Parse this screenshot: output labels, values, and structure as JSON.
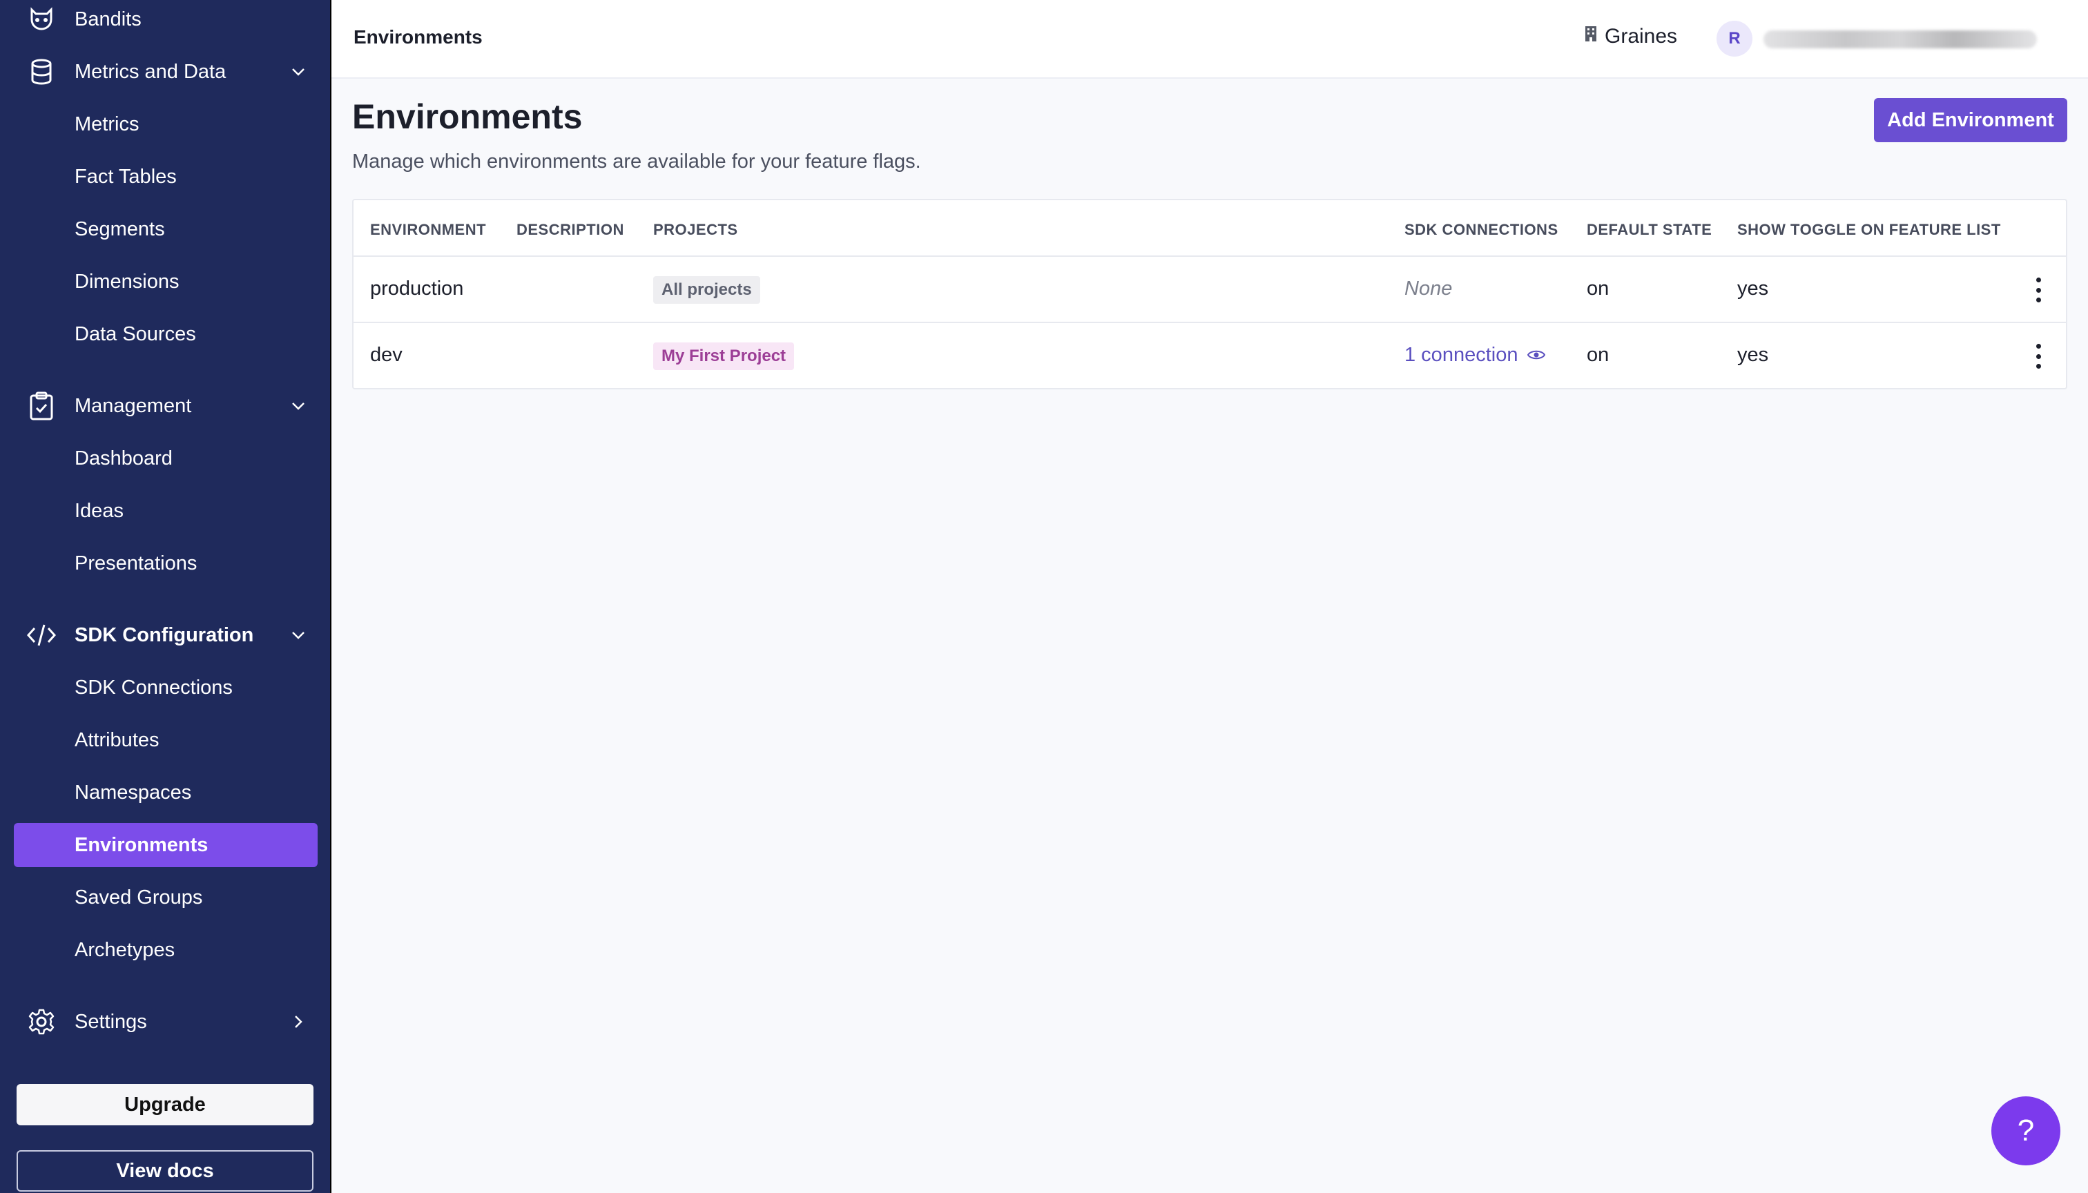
{
  "sidebar": {
    "groups": [
      {
        "label": "Bandits",
        "icon": "raccoon-icon"
      },
      {
        "label": "Metrics and Data",
        "icon": "database-icon",
        "items": [
          "Metrics",
          "Fact Tables",
          "Segments",
          "Dimensions",
          "Data Sources"
        ]
      },
      {
        "label": "Management",
        "icon": "clipboard-check-icon",
        "items": [
          "Dashboard",
          "Ideas",
          "Presentations"
        ]
      },
      {
        "label": "SDK Configuration",
        "icon": "code-icon",
        "items": [
          "SDK Connections",
          "Attributes",
          "Namespaces",
          "Environments",
          "Saved Groups",
          "Archetypes"
        ]
      },
      {
        "label": "Settings",
        "icon": "gear-icon"
      }
    ],
    "active_item": "Environments",
    "upgrade_label": "Upgrade",
    "docs_label": "View docs"
  },
  "topbar": {
    "title": "Environments",
    "org_name": "Graines",
    "avatar_initial": "R"
  },
  "main": {
    "title": "Environments",
    "subtitle": "Manage which environments are available for your feature flags.",
    "add_button": "Add Environment",
    "table": {
      "headers": [
        "ENVIRONMENT",
        "DESCRIPTION",
        "PROJECTS",
        "SDK CONNECTIONS",
        "DEFAULT STATE",
        "SHOW TOGGLE ON FEATURE LIST"
      ],
      "rows": [
        {
          "environment": "production",
          "description": "",
          "project": "All projects",
          "sdk_connections": "None",
          "default_state": "on",
          "show_toggle": "yes"
        },
        {
          "environment": "dev",
          "description": "",
          "project": "My First Project",
          "sdk_connections": "1 connection",
          "default_state": "on",
          "show_toggle": "yes"
        }
      ]
    }
  },
  "help_label": "?",
  "colors": {
    "sidebar_bg": "#1f2a5c",
    "active_item_bg": "#7c4dea",
    "primary_button": "#6a4fd2",
    "help_button": "#7c3aed"
  }
}
